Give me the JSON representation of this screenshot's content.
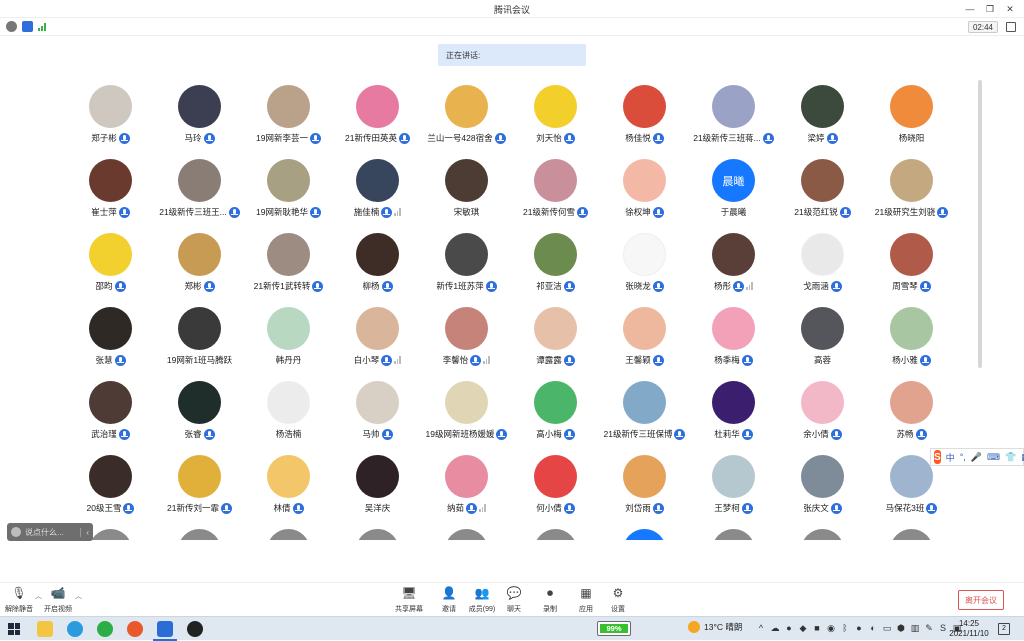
{
  "window": {
    "title": "腾讯会议",
    "timer": "02:44"
  },
  "colors": {
    "accent": "#2f6fdb",
    "leave": "#e05353",
    "speaking_bg": "#dce9fb"
  },
  "speaking": {
    "label": "正在讲话:"
  },
  "participants": [
    {
      "name": "郑子彬",
      "speaking": false,
      "bg": "#cfc8c0"
    },
    {
      "name": "马玲",
      "speaking": false,
      "bg": "#3c3f52"
    },
    {
      "name": "19网新李芸一",
      "speaking": false,
      "bg": "#b9a18a"
    },
    {
      "name": "21新传田英英",
      "speaking": false,
      "bg": "#e77aa1"
    },
    {
      "name": "兰山一号428宿舍",
      "speaking": false,
      "bg": "#e8b24e"
    },
    {
      "name": "刘天怡",
      "speaking": false,
      "bg": "#f2cf2a"
    },
    {
      "name": "杨佳悦",
      "speaking": false,
      "bg": "#d94d3a"
    },
    {
      "name": "21级新传三班蒋...",
      "speaking": false,
      "bg": "#9aa2c6"
    },
    {
      "name": "梁婷",
      "speaking": false,
      "bg": "#3b4a3d"
    },
    {
      "name": "杨晓阳",
      "speaking": false,
      "bg": "#ef8b3b",
      "mic": false
    },
    {
      "name": "崔士萍",
      "speaking": false,
      "bg": "#6a3a2e"
    },
    {
      "name": "21级新传三班王...",
      "speaking": false,
      "bg": "#8a7d76"
    },
    {
      "name": "19网新耿艳华",
      "speaking": false,
      "bg": "#a8a083"
    },
    {
      "name": "施佳楠",
      "speaking": true,
      "bg": "#37465c"
    },
    {
      "name": "宋敏琪",
      "speaking": false,
      "bg": "#4d3c34",
      "mic": false
    },
    {
      "name": "21级新传何雪",
      "speaking": false,
      "bg": "#c98f9b"
    },
    {
      "name": "徐权坤",
      "speaking": false,
      "bg": "#f4b8a6"
    },
    {
      "name": "于晨曦",
      "speaking": false,
      "bg": "#1677ff",
      "text": "晨曦",
      "mic": false
    },
    {
      "name": "21级范红锐",
      "speaking": false,
      "bg": "#8b5a47"
    },
    {
      "name": "21级研究生刘骁",
      "speaking": false,
      "bg": "#c4a980"
    },
    {
      "name": "邵昀",
      "speaking": false,
      "bg": "#f2d02d"
    },
    {
      "name": "郑彬",
      "speaking": false,
      "bg": "#c79b54"
    },
    {
      "name": "21新传1武转转",
      "speaking": false,
      "bg": "#9c8c82"
    },
    {
      "name": "柳杨",
      "speaking": false,
      "bg": "#3e2d27"
    },
    {
      "name": "新传1班苏萍",
      "speaking": false,
      "bg": "#4a4a4a"
    },
    {
      "name": "祁亚洁",
      "speaking": false,
      "bg": "#6c8b4e"
    },
    {
      "name": "张晓龙",
      "speaking": false,
      "bg": "#f7f7f7"
    },
    {
      "name": "杨彤",
      "speaking": true,
      "bg": "#5a3e38"
    },
    {
      "name": "戈雨涵",
      "speaking": false,
      "bg": "#e9e9e9"
    },
    {
      "name": "周雪琴",
      "speaking": false,
      "bg": "#b05a4a"
    },
    {
      "name": "张慧",
      "speaking": false,
      "bg": "#2f2926"
    },
    {
      "name": "19网新1班马腾跃",
      "speaking": false,
      "bg": "#3a3a3a",
      "mic": false
    },
    {
      "name": "韩丹丹",
      "speaking": false,
      "bg": "#b8d8c2",
      "mic": false
    },
    {
      "name": "白小琴",
      "speaking": true,
      "bg": "#d9b59c"
    },
    {
      "name": "李馨怡",
      "speaking": true,
      "bg": "#c6837a"
    },
    {
      "name": "谭露露",
      "speaking": false,
      "bg": "#e7c0a9"
    },
    {
      "name": "王馨颖",
      "speaking": false,
      "bg": "#eeb89e"
    },
    {
      "name": "杨季梅",
      "speaking": false,
      "bg": "#f3a1b9"
    },
    {
      "name": "高蓉",
      "speaking": false,
      "bg": "#54565c",
      "mic": false
    },
    {
      "name": "杨小雅",
      "speaking": false,
      "bg": "#a9c6a2"
    },
    {
      "name": "武治瑾",
      "speaking": false,
      "bg": "#4e3b35"
    },
    {
      "name": "张睿",
      "speaking": false,
      "bg": "#1f2e2a"
    },
    {
      "name": "杨浩楠",
      "speaking": false,
      "bg": "#ececec",
      "mic": false
    },
    {
      "name": "马帅",
      "speaking": false,
      "bg": "#d8d0c4"
    },
    {
      "name": "19级网新班杨媛媛",
      "speaking": false,
      "bg": "#e0d6b5"
    },
    {
      "name": "高小梅",
      "speaking": false,
      "bg": "#4bb66a"
    },
    {
      "name": "21级新传三班保博",
      "speaking": false,
      "bg": "#83a9c9"
    },
    {
      "name": "杜莉华",
      "speaking": false,
      "bg": "#3b1e6d"
    },
    {
      "name": "余小倩",
      "speaking": false,
      "bg": "#f3b8c7"
    },
    {
      "name": "苏畅",
      "speaking": false,
      "bg": "#e2a38e"
    },
    {
      "name": "20级王雪",
      "speaking": false,
      "bg": "#3a2c28"
    },
    {
      "name": "21新传刘一霏",
      "speaking": false,
      "bg": "#e1b03a"
    },
    {
      "name": "林倩",
      "speaking": false,
      "bg": "#f4c66a"
    },
    {
      "name": "吴洋庆",
      "speaking": false,
      "bg": "#2e2226",
      "mic": false
    },
    {
      "name": "纳茹",
      "speaking": true,
      "bg": "#e78ca1"
    },
    {
      "name": "何小倩",
      "speaking": false,
      "bg": "#e64545"
    },
    {
      "name": "刘岱雨",
      "speaking": false,
      "bg": "#e5a25b"
    },
    {
      "name": "王梦柯",
      "speaking": false,
      "bg": "#b6c8cf"
    },
    {
      "name": "张庆文",
      "speaking": false,
      "bg": "#7e8c99"
    },
    {
      "name": "马保花3班",
      "speaking": false,
      "bg": "#9fb5cf"
    }
  ],
  "chat": {
    "placeholder": "说点什么..."
  },
  "ime": {
    "lang": "中"
  },
  "toolbar": {
    "mute": "解除静音",
    "video": "开启视频",
    "share": "共享屏幕",
    "invite": "邀请",
    "members": "成员(99)",
    "chat": "聊天",
    "record": "录制",
    "apps": "应用",
    "settings": "设置",
    "leave": "离开会议"
  },
  "taskbar": {
    "battery": "99%",
    "battery_level": 0.99,
    "weather": "13°C  晴朗",
    "time": "14:25",
    "date": "2021/11/10",
    "notifications": "2"
  }
}
